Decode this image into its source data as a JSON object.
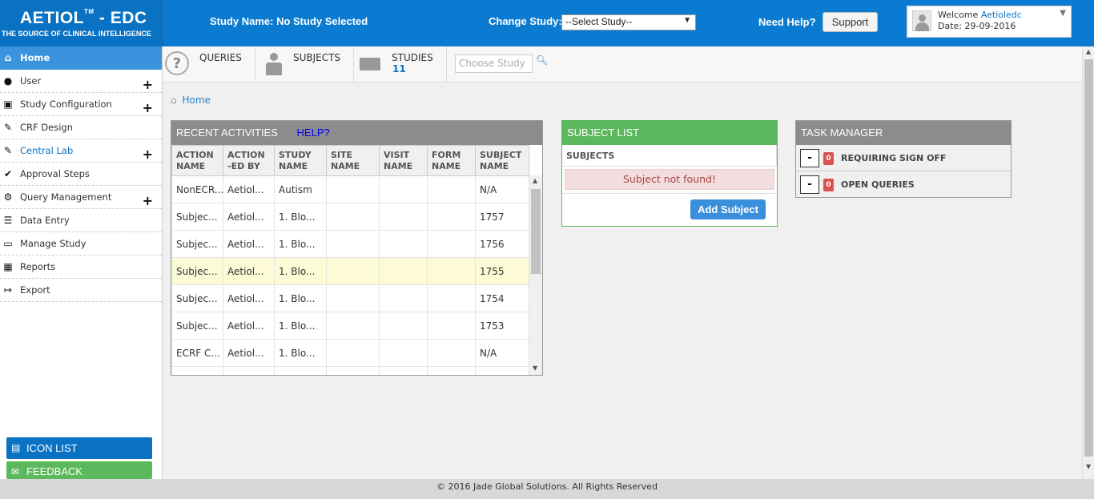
{
  "header": {
    "logo_title": "AETIOL",
    "logo_tm": "TM",
    "logo_suffix": " - EDC",
    "logo_subtitle": "THE SOURCE OF CLINICAL INTELLIGENCE",
    "study_name": "Study Name: No Study Selected",
    "change_study_label": "Change Study:",
    "select_study_value": "--Select Study--",
    "need_help": "Need Help?",
    "support_label": "Support",
    "welcome_text": "Welcome",
    "user_name": "Aetioledc",
    "date": "Date: 29-09-2016",
    "brand_color": "#0a7bd0"
  },
  "sidebar": {
    "items": [
      {
        "label": "Home",
        "icon": "home-icon",
        "active": true
      },
      {
        "label": "User",
        "icon": "user-icon"
      },
      {
        "label": "Study Configuration",
        "icon": "study-config-icon"
      },
      {
        "label": "CRF Design",
        "icon": "crf-design-icon"
      },
      {
        "label": "Central Lab",
        "icon": "central-lab-icon"
      },
      {
        "label": "Approval Steps",
        "icon": "check-badge-icon"
      },
      {
        "label": "Query Management",
        "icon": "query-mgmt-icon"
      },
      {
        "label": "Data Entry",
        "icon": "data-entry-icon"
      },
      {
        "label": "Manage Study",
        "icon": "manage-study-icon"
      },
      {
        "label": "Reports",
        "icon": "reports-icon"
      },
      {
        "label": "Export",
        "icon": "export-icon"
      }
    ],
    "icon_list_label": "ICON LIST",
    "feedback_label": "FEEDBACK"
  },
  "topnav": {
    "queries_label": "QUERIES",
    "subjects_label": "SUBJECTS",
    "studies_label": "STUDIES",
    "studies_count": "11",
    "choose_study_placeholder": "Choose Study"
  },
  "breadcrumb": {
    "home": "Home"
  },
  "recent_activities": {
    "title": "RECENT ACTIVITIES",
    "help_label": "HELP?",
    "columns": [
      "ACTION NAME",
      "ACTION -ED BY",
      "STUDY NAME",
      "SITE NAME",
      "VISIT NAME",
      "FORM NAME",
      "SUBJECT NAME"
    ],
    "rows": [
      [
        "NonECR...",
        "Aetiol...",
        "Autism",
        "",
        "",
        "",
        "N/A"
      ],
      [
        "Subjec...",
        "Aetiol...",
        "1. Blo...",
        "",
        "",
        "",
        "1757"
      ],
      [
        "Subjec...",
        "Aetiol...",
        "1. Blo...",
        "",
        "",
        "",
        "1756"
      ],
      [
        "Subjec...",
        "Aetiol...",
        "1. Blo...",
        "",
        "",
        "",
        "1755"
      ],
      [
        "Subjec...",
        "Aetiol...",
        "1. Blo...",
        "",
        "",
        "",
        "1754"
      ],
      [
        "Subjec...",
        "Aetiol...",
        "1. Blo...",
        "",
        "",
        "",
        "1753"
      ],
      [
        "ECRF C...",
        "Aetiol...",
        "1. Blo...",
        "",
        "",
        "",
        "N/A"
      ]
    ]
  },
  "subject_list": {
    "title": "SUBJECT LIST",
    "subheader": "SUBJECTS",
    "empty_message": "Subject not found!",
    "add_button": "Add Subject"
  },
  "task_manager": {
    "title": "TASK MANAGER",
    "rows": [
      {
        "label": "REQUIRING SIGN OFF",
        "count": "0",
        "toggle": "-"
      },
      {
        "label": "OPEN QUERIES",
        "count": "0",
        "toggle": "-"
      }
    ]
  },
  "footer": {
    "text": "© 2016 Jade Global Solutions. All Rights Reserved"
  }
}
